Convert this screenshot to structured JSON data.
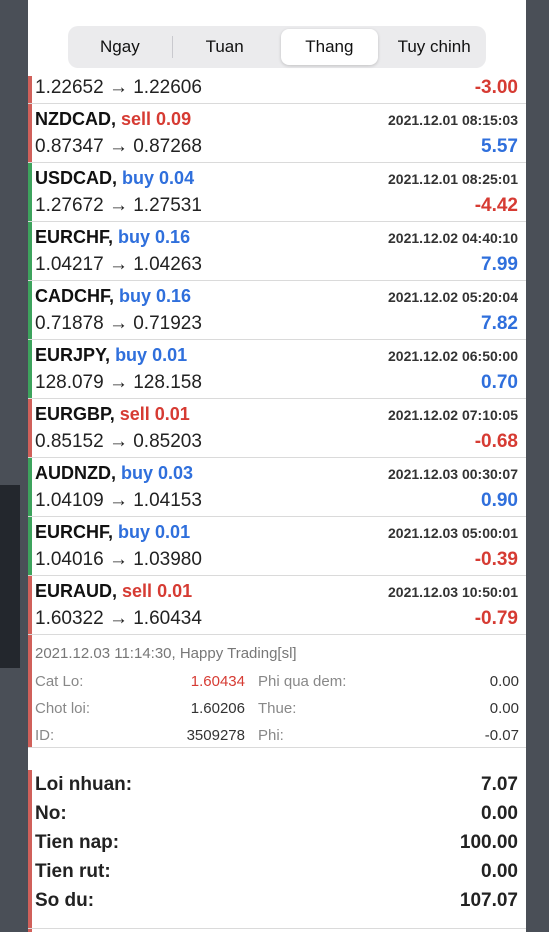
{
  "tabs": [
    "Ngay",
    "Tuan",
    "Thang",
    "Tuy chinh"
  ],
  "active_tab": "Thang",
  "first_row": {
    "prices": "1.22652 → 1.22606",
    "profit": "-3.00",
    "sign": "neg"
  },
  "trades": [
    {
      "symbol": "NZDCAD,",
      "type": "sell",
      "volume": "0.09",
      "time": "2021.12.01 08:15:03",
      "prices": "0.87347 → 0.87268",
      "profit": "5.57",
      "sign": "pos"
    },
    {
      "symbol": "USDCAD,",
      "type": "buy",
      "volume": "0.04",
      "time": "2021.12.01 08:25:01",
      "prices": "1.27672 → 1.27531",
      "profit": "-4.42",
      "sign": "neg"
    },
    {
      "symbol": "EURCHF,",
      "type": "buy",
      "volume": "0.16",
      "time": "2021.12.02 04:40:10",
      "prices": "1.04217 → 1.04263",
      "profit": "7.99",
      "sign": "pos"
    },
    {
      "symbol": "CADCHF,",
      "type": "buy",
      "volume": "0.16",
      "time": "2021.12.02 05:20:04",
      "prices": "0.71878 → 0.71923",
      "profit": "7.82",
      "sign": "pos"
    },
    {
      "symbol": "EURJPY,",
      "type": "buy",
      "volume": "0.01",
      "time": "2021.12.02 06:50:00",
      "prices": "128.079 → 128.158",
      "profit": "0.70",
      "sign": "pos"
    },
    {
      "symbol": "EURGBP,",
      "type": "sell",
      "volume": "0.01",
      "time": "2021.12.02 07:10:05",
      "prices": "0.85152 → 0.85203",
      "profit": "-0.68",
      "sign": "neg"
    },
    {
      "symbol": "AUDNZD,",
      "type": "buy",
      "volume": "0.03",
      "time": "2021.12.03 00:30:07",
      "prices": "1.04109 → 1.04153",
      "profit": "0.90",
      "sign": "pos"
    },
    {
      "symbol": "EURCHF,",
      "type": "buy",
      "volume": "0.01",
      "time": "2021.12.03 05:00:01",
      "prices": "1.04016 → 1.03980",
      "profit": "-0.39",
      "sign": "neg"
    },
    {
      "symbol": "EURAUD,",
      "type": "sell",
      "volume": "0.01",
      "time": "2021.12.03 10:50:01",
      "prices": "1.60322 → 1.60434",
      "profit": "-0.79",
      "sign": "neg"
    }
  ],
  "detail": {
    "comment": "2021.12.03 11:14:30, Happy Trading[sl]",
    "sl_label": "Cat Lo:",
    "sl_value": "1.60434",
    "tp_label": "Chot loi:",
    "tp_value": "1.60206",
    "id_label": "ID:",
    "id_value": "3509278",
    "swap_label": "Phi qua dem:",
    "swap_value": "0.00",
    "tax_label": "Thue:",
    "tax_value": "0.00",
    "fee_label": "Phi:",
    "fee_value": "-0.07"
  },
  "summary": [
    {
      "label": "Loi nhuan:",
      "value": "7.07"
    },
    {
      "label": "No:",
      "value": "0.00"
    },
    {
      "label": "Tien nap:",
      "value": "100.00"
    },
    {
      "label": "Tien rut:",
      "value": "0.00"
    },
    {
      "label": "So du:",
      "value": "107.07"
    }
  ],
  "colors": {
    "buy": "#2f6fdc",
    "sell": "#d63b33",
    "buy_bar": "#3da35d",
    "sell_bar": "#d0605a"
  }
}
